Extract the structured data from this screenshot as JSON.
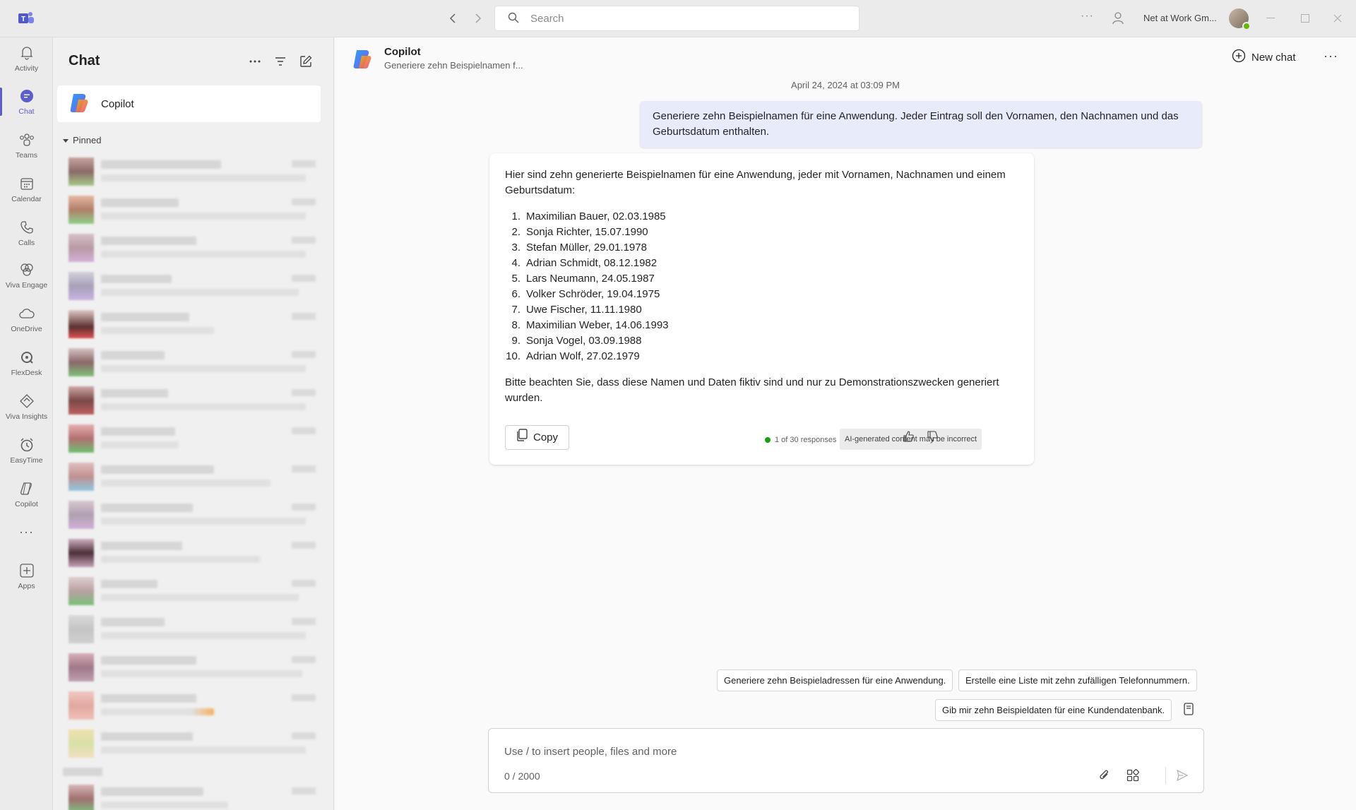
{
  "titlebar": {
    "search_placeholder": "Search",
    "org_name": "Net at Work Gm...",
    "more": "···"
  },
  "rail": {
    "items": [
      {
        "label": "Activity",
        "icon": "bell-icon"
      },
      {
        "label": "Chat",
        "icon": "chat-icon",
        "active": true
      },
      {
        "label": "Teams",
        "icon": "teams-icon"
      },
      {
        "label": "Calendar",
        "icon": "calendar-icon"
      },
      {
        "label": "Calls",
        "icon": "phone-icon"
      },
      {
        "label": "Viva Engage",
        "icon": "viva-engage-icon"
      },
      {
        "label": "OneDrive",
        "icon": "cloud-icon"
      },
      {
        "label": "FlexDesk",
        "icon": "flexdesk-icon"
      },
      {
        "label": "Viva Insights",
        "icon": "viva-insights-icon"
      },
      {
        "label": "EasyTime",
        "icon": "clock-icon"
      },
      {
        "label": "Copilot",
        "icon": "copilot-icon"
      }
    ],
    "more": "···",
    "apps_label": "Apps"
  },
  "chatlist": {
    "title": "Chat",
    "copilot_name": "Copilot",
    "pinned_label": "Pinned"
  },
  "main": {
    "header_title": "Copilot",
    "header_subtitle": "Generiere zehn Beispielnamen f...",
    "new_chat_label": "New chat",
    "more": "···",
    "timestamp": "April 24, 2024 at 03:09 PM",
    "user_message": "Generiere zehn Beispielnamen für eine Anwendung. Jeder Eintrag soll den Vornamen, den Nachnamen und das Geburtsdatum enthalten.",
    "bot_intro": "Hier sind zehn generierte Beispielnamen für eine Anwendung, jeder mit Vornamen, Nachnamen und einem Geburtsdatum:",
    "bot_list": [
      {
        "num": "1.",
        "text": "Maximilian Bauer, 02.03.1985"
      },
      {
        "num": "2.",
        "text": "Sonja Richter, 15.07.1990"
      },
      {
        "num": "3.",
        "text": "Stefan Müller, 29.01.1978"
      },
      {
        "num": "4.",
        "text": "Adrian Schmidt, 08.12.1982"
      },
      {
        "num": "5.",
        "text": "Lars Neumann, 24.05.1987"
      },
      {
        "num": "6.",
        "text": "Volker Schröder, 19.04.1975"
      },
      {
        "num": "7.",
        "text": "Uwe Fischer, 11.11.1980"
      },
      {
        "num": "8.",
        "text": "Maximilian Weber, 14.06.1993"
      },
      {
        "num": "9.",
        "text": "Sonja Vogel, 03.09.1988"
      },
      {
        "num": "10.",
        "text": "Adrian Wolf, 27.02.1979"
      }
    ],
    "bot_outro": "Bitte beachten Sie, dass diese Namen und Daten fiktiv sind und nur zu Demonstrationszwecken generiert wurden.",
    "copy_label": "Copy",
    "responses_label": "1 of 30 responses",
    "ai_badge": "AI-generated content may be incorrect",
    "suggestions": [
      "Generiere zehn Beispieladressen für eine Anwendung.",
      "Erstelle eine Liste mit zehn zufälligen Telefonnummern.",
      "Gib mir zehn Beispieldaten für eine Kundendatenbank."
    ],
    "compose_placeholder": "Use / to insert people, files and more",
    "char_count": "0 / 2000"
  },
  "colors": {
    "accent": "#5b5fc7",
    "user_bubble": "#e8ebfa",
    "presence": "#6bb700"
  }
}
